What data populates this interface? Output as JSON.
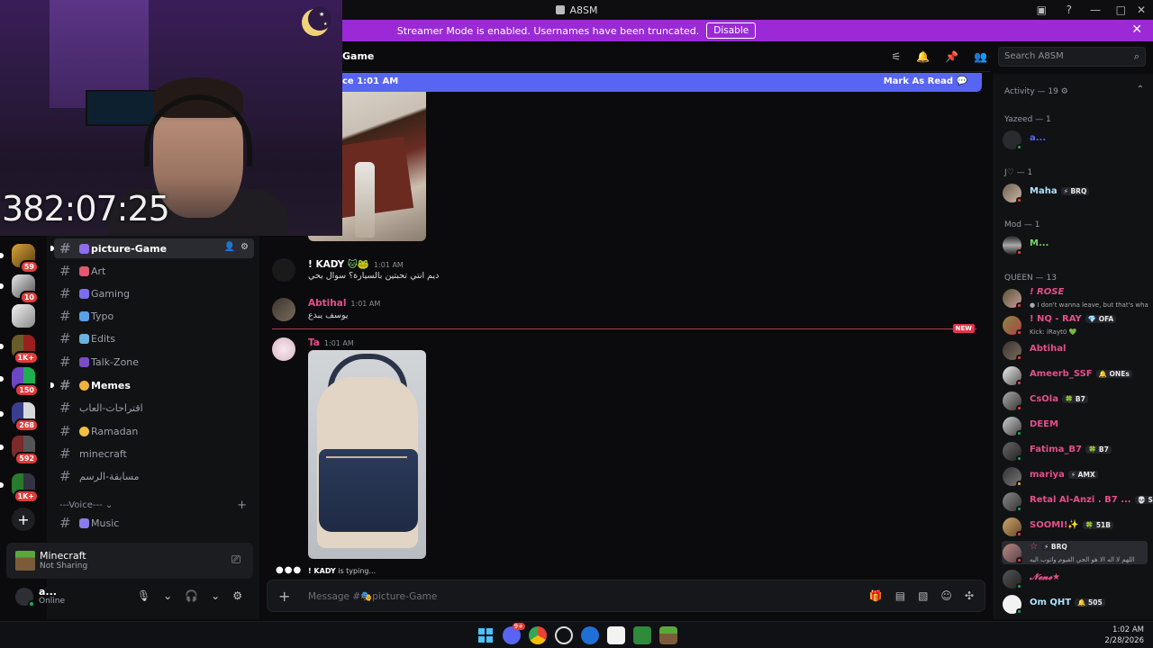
{
  "app": {
    "window_title": "A8SM"
  },
  "banner": {
    "text": "Streamer Mode is enabled. Usernames have been truncated.",
    "disable_label": "Disable"
  },
  "overlay": {
    "timer": "382:07:25"
  },
  "header": {
    "channel": "Game",
    "search_placeholder": "Search A8SM"
  },
  "new_bar": {
    "left_text": "ce 1:01 AM",
    "right_text": "Mark As Read"
  },
  "server_badges": [
    "59",
    "10",
    "1K+",
    "150",
    "268",
    "592",
    "1K+"
  ],
  "channels": [
    {
      "name": "picture-Game",
      "active": true
    },
    {
      "name": "Art"
    },
    {
      "name": "Gaming"
    },
    {
      "name": "Typo"
    },
    {
      "name": "Edits"
    },
    {
      "name": "Talk-Zone"
    },
    {
      "name": "Memes",
      "bold": true
    },
    {
      "name": "اقتراحات-العاب"
    },
    {
      "name": "Ramadan"
    },
    {
      "name": "minecraft"
    },
    {
      "name": "مسابقة-الرسم"
    }
  ],
  "voice_category": "---Voice---",
  "voice_channel": "Music",
  "activity": {
    "title": "Minecraft",
    "subtitle": "Not Sharing"
  },
  "user": {
    "name": "a...",
    "status": "Online"
  },
  "messages": [
    {
      "author": "! KADY",
      "time": "1:01 AM",
      "text": "ديم انتي تحبتين بالسيارة؟ سوال يحي"
    },
    {
      "author": "Abtihal",
      "time": "1:01 AM",
      "text": "يوسف يبدع"
    },
    {
      "author": "Ta",
      "time": "1:01 AM"
    }
  ],
  "new_tag": "NEW",
  "typing": {
    "user": "! KADY",
    "suffix": "is typing..."
  },
  "composer": {
    "placeholder": "Message #🎭picture-Game"
  },
  "members": {
    "activity_header": "Activity — 19",
    "sections": [
      {
        "title": "Yazeed — 1",
        "members": [
          {
            "name": "a...",
            "color": "#5865f2"
          }
        ]
      },
      {
        "title": "J♡ — 1",
        "members": [
          {
            "name": "Maha",
            "tag": "⚡ BRQ",
            "color": "#aee3ff"
          }
        ]
      },
      {
        "title": "Mod — 1",
        "members": [
          {
            "name": "M...",
            "color": "#77d56b"
          }
        ]
      },
      {
        "title": "QUEEN — 13",
        "members": [
          {
            "name": "! ROSE",
            "sub": "● I don't wanna leave, but that's wha",
            "color": "#e64f8b"
          },
          {
            "name": "! NQ - RAY",
            "tag": "💎 OFA",
            "sub": "Kick: iRayt0 💚",
            "color": "#e64f8b"
          },
          {
            "name": "Abtihal",
            "color": "#e64f8b"
          },
          {
            "name": "Ameerb_SSF",
            "tag": "🔔 ONEs",
            "color": "#e64f8b"
          },
          {
            "name": "CsOla",
            "tag": "🍀 B7",
            "color": "#e64f8b"
          },
          {
            "name": "DEEM",
            "color": "#e64f8b"
          },
          {
            "name": "Fatima_B7",
            "tag": "🍀 B7",
            "color": "#e64f8b"
          },
          {
            "name": "mariya",
            "tag": "⚡ AMX",
            "color": "#e64f8b"
          },
          {
            "name": "Retal Al-Anzi . B7 ...",
            "tag": "💀 SXB",
            "color": "#e64f8b"
          },
          {
            "name": "SOOMI!✨",
            "tag": "🍀 51B",
            "color": "#e64f8b"
          },
          {
            "name": "☆",
            "tag": "⚡ BRQ",
            "sub": "اللهم لا اله الا هو الحي القيوم واتوب اليه",
            "color": "#e64f8b"
          },
          {
            "name": "𝓝𝓮𝓷𝓮★",
            "color": "#e64f8b"
          },
          {
            "name": "Om QHT",
            "tag": "🔔 505",
            "color": "#aee3ff"
          }
        ]
      }
    ]
  },
  "taskbar": {
    "time": "1:02 AM",
    "date": "2/28/2026",
    "discord_badge": "9+"
  },
  "colors": {
    "banner": "#9b2ad6",
    "new_bar": "#5865f2",
    "online": "#23a55a",
    "dnd": "#f23f43",
    "idle": "#f0b232"
  }
}
